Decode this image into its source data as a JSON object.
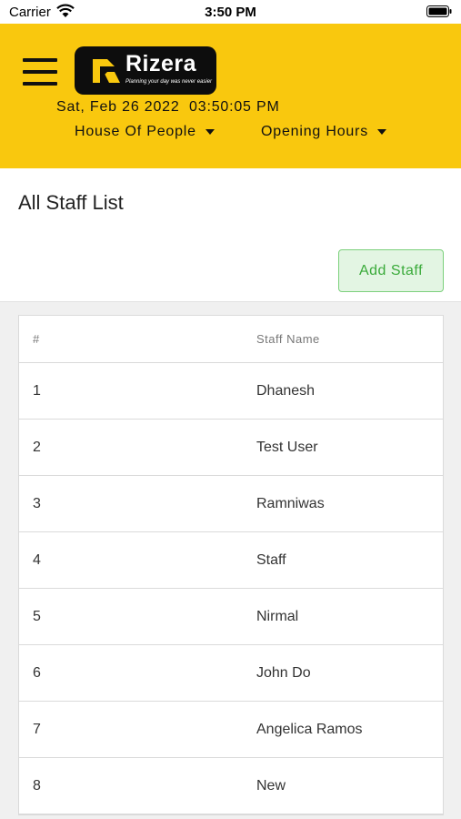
{
  "status_bar": {
    "carrier": "Carrier",
    "time": "3:50 PM"
  },
  "header": {
    "logo_name": "Rizera",
    "logo_tagline": "Planning your day was never easier",
    "datetime": "Sat, Feb 26 2022  03:50:05 PM",
    "dropdown_location": "House Of People",
    "dropdown_hours": "Opening Hours",
    "background_color": "#f9c80e"
  },
  "page": {
    "title": "All Staff List",
    "add_button": "Add Staff",
    "add_button_color": "#3aaa3a"
  },
  "table": {
    "columns": [
      "#",
      "Staff Name"
    ],
    "rows": [
      [
        "1",
        "Dhanesh"
      ],
      [
        "2",
        "Test User"
      ],
      [
        "3",
        "Ramniwas"
      ],
      [
        "4",
        "Staff"
      ],
      [
        "5",
        "Nirmal"
      ],
      [
        "6",
        "John Do"
      ],
      [
        "7",
        "Angelica Ramos"
      ],
      [
        "8",
        "New"
      ]
    ]
  }
}
